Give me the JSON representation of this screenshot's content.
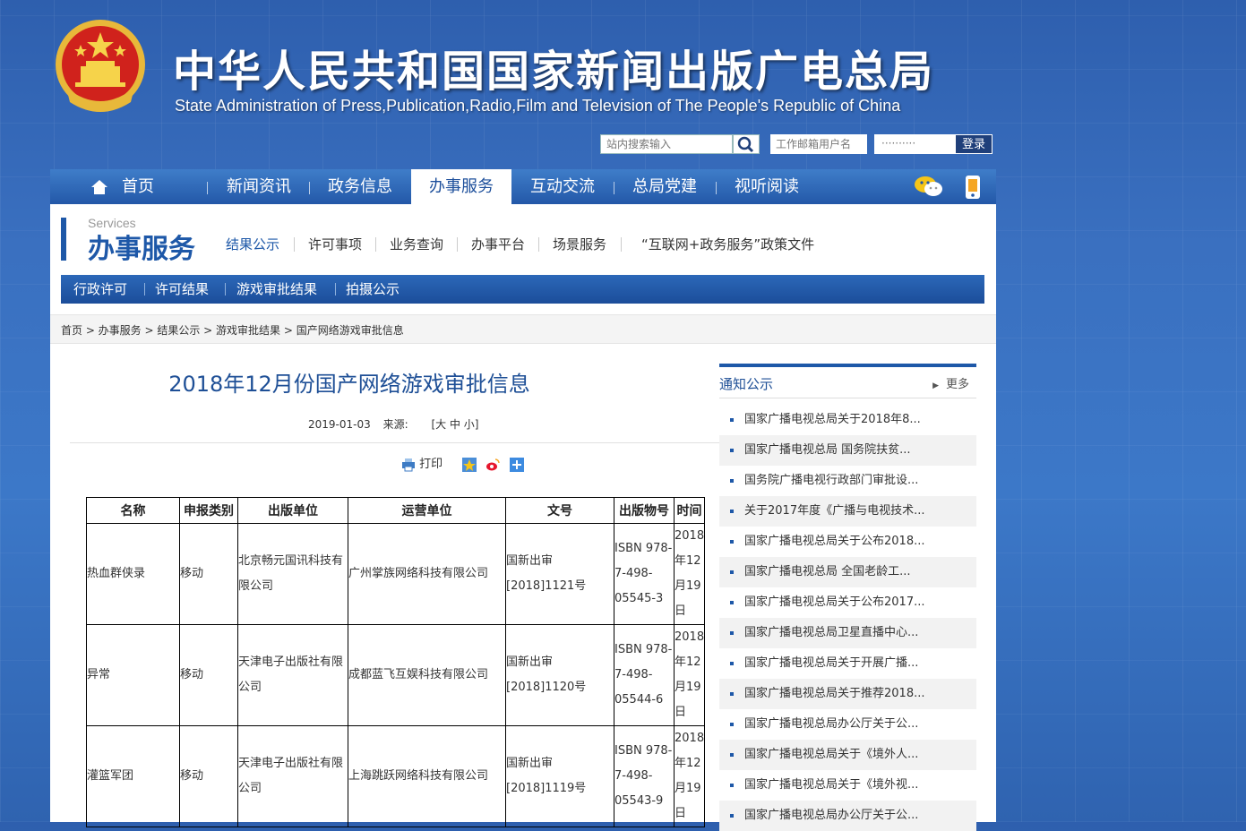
{
  "header": {
    "title_cn": "中华人民共和国国家新闻出版广电总局",
    "title_en": "State Administration of Press,Publication,Radio,Film and Television of The People's Republic of China",
    "search_placeholder": "站内搜索输入",
    "username_placeholder": "工作邮箱用户名",
    "password_mask": "··········",
    "login_label": "登录"
  },
  "nav": {
    "items": [
      "首页",
      "新闻资讯",
      "政务信息",
      "办事服务",
      "互动交流",
      "总局党建",
      "视听阅读"
    ],
    "active": "办事服务"
  },
  "services": {
    "en": "Services",
    "cn": "办事服务",
    "subnav": [
      "结果公示",
      "许可事项",
      "业务查询",
      "办事平台",
      "场景服务",
      "“互联网+政务服务”政策文件"
    ],
    "tabs": [
      "行政许可",
      "许可结果",
      "游戏审批结果",
      "拍摄公示"
    ]
  },
  "breadcrumb": "首页 > 办事服务 > 结果公示 > 游戏审批结果 > 国产网络游戏审批信息",
  "article": {
    "title": "2018年12月份国产网络游戏审批信息",
    "date": "2019-01-03",
    "source_label": "来源:",
    "size_ctrl": "[大 中 小]",
    "print_label": "打印"
  },
  "table": {
    "headers": [
      "名称",
      "申报类别",
      "出版单位",
      "运营单位",
      "文号",
      "出版物号",
      "时间"
    ],
    "rows": [
      {
        "name": "热血群侠录",
        "type": "移动",
        "publisher": "北京畅元国讯科技有限公司",
        "operator": "广州掌族网络科技有限公司",
        "doc": "国新出审[2018]1121号",
        "isbn": "ISBN 978-7-498-05545-3",
        "time": "2018年12月19日"
      },
      {
        "name": "异常",
        "type": "移动",
        "publisher": "天津电子出版社有限公司",
        "operator": "成都蓝飞互娱科技有限公司",
        "doc": "国新出审[2018]1120号",
        "isbn": "ISBN 978-7-498-05544-6",
        "time": "2018年12月19日"
      },
      {
        "name": "灌篮军团",
        "type": "移动",
        "publisher": "天津电子出版社有限公司",
        "operator": "上海跳跃网络科技有限公司",
        "doc": "国新出审[2018]1119号",
        "isbn": "ISBN 978-7-498-05543-9",
        "time": "2018年12月19日"
      }
    ]
  },
  "sidebar": {
    "heading": "通知公示",
    "more": "更多",
    "items": [
      "国家广播电视总局关于2018年8...",
      "国家广播电视总局 国务院扶贫...",
      "国务院广播电视行政部门审批设...",
      "关于2017年度《广播与电视技术...",
      "国家广播电视总局关于公布2018...",
      "国家广播电视总局 全国老龄工...",
      "国家广播电视总局关于公布2017...",
      "国家广播电视总局卫星直播中心...",
      "国家广播电视总局关于开展广播...",
      "国家广播电视总局关于推荐2018...",
      "国家广播电视总局办公厅关于公...",
      "国家广播电视总局关于《境外人...",
      "国家广播电视总局关于《境外视...",
      "国家广播电视总局办公厅关于公..."
    ]
  },
  "colors": {
    "brand_blue": "#1e58a8",
    "title_blue": "#1e4f96",
    "bg_blue": "#3a70c0"
  }
}
